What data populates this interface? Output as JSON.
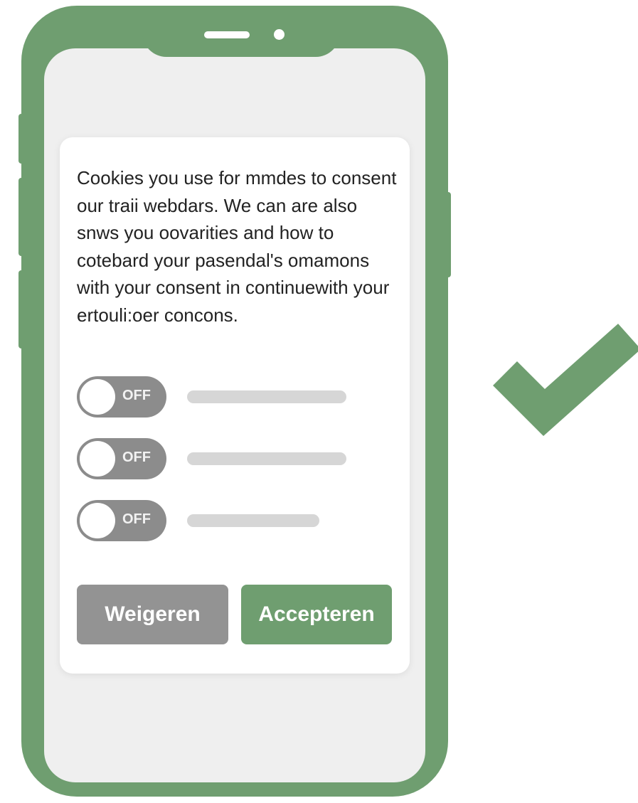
{
  "consent": {
    "text": "Cookies you use for mmdes to consent our traii webdars. We can are also snws you oovarities and how to cotebard your pasendal's omamons with your consent in continuewith your ertouli:oer concons.",
    "toggles": [
      {
        "label": "OFF",
        "state": "off"
      },
      {
        "label": "OFF",
        "state": "off"
      },
      {
        "label": "OFF",
        "state": "off"
      }
    ],
    "decline_label": "Weigeren",
    "accept_label": "Accepteren"
  },
  "colors": {
    "phone_frame": "#6f9e70",
    "accent_green": "#6f9e70",
    "toggle_off": "#8c8c8c",
    "decline_button": "#939393"
  },
  "icons": {
    "checkmark": "checkmark-icon"
  }
}
